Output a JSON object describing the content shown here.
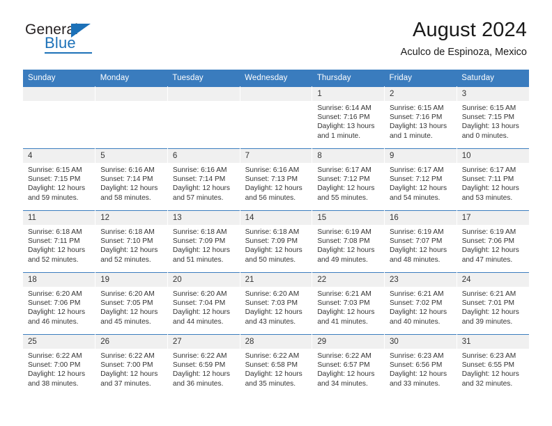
{
  "brand": {
    "name_top": "General",
    "name_bottom": "Blue",
    "triangle_color": "#1c71b8"
  },
  "header": {
    "title": "August 2024",
    "subtitle": "Aculco de Espinoza, Mexico",
    "header_bg": "#3a7cbe"
  },
  "weekday_headers": [
    "Sunday",
    "Monday",
    "Tuesday",
    "Wednesday",
    "Thursday",
    "Friday",
    "Saturday"
  ],
  "weeks": [
    [
      {
        "day": "",
        "lines": []
      },
      {
        "day": "",
        "lines": []
      },
      {
        "day": "",
        "lines": []
      },
      {
        "day": "",
        "lines": []
      },
      {
        "day": "1",
        "lines": [
          "Sunrise: 6:14 AM",
          "Sunset: 7:16 PM",
          "Daylight: 13 hours",
          "and 1 minute."
        ]
      },
      {
        "day": "2",
        "lines": [
          "Sunrise: 6:15 AM",
          "Sunset: 7:16 PM",
          "Daylight: 13 hours",
          "and 1 minute."
        ]
      },
      {
        "day": "3",
        "lines": [
          "Sunrise: 6:15 AM",
          "Sunset: 7:15 PM",
          "Daylight: 13 hours",
          "and 0 minutes."
        ]
      }
    ],
    [
      {
        "day": "4",
        "lines": [
          "Sunrise: 6:15 AM",
          "Sunset: 7:15 PM",
          "Daylight: 12 hours",
          "and 59 minutes."
        ]
      },
      {
        "day": "5",
        "lines": [
          "Sunrise: 6:16 AM",
          "Sunset: 7:14 PM",
          "Daylight: 12 hours",
          "and 58 minutes."
        ]
      },
      {
        "day": "6",
        "lines": [
          "Sunrise: 6:16 AM",
          "Sunset: 7:14 PM",
          "Daylight: 12 hours",
          "and 57 minutes."
        ]
      },
      {
        "day": "7",
        "lines": [
          "Sunrise: 6:16 AM",
          "Sunset: 7:13 PM",
          "Daylight: 12 hours",
          "and 56 minutes."
        ]
      },
      {
        "day": "8",
        "lines": [
          "Sunrise: 6:17 AM",
          "Sunset: 7:12 PM",
          "Daylight: 12 hours",
          "and 55 minutes."
        ]
      },
      {
        "day": "9",
        "lines": [
          "Sunrise: 6:17 AM",
          "Sunset: 7:12 PM",
          "Daylight: 12 hours",
          "and 54 minutes."
        ]
      },
      {
        "day": "10",
        "lines": [
          "Sunrise: 6:17 AM",
          "Sunset: 7:11 PM",
          "Daylight: 12 hours",
          "and 53 minutes."
        ]
      }
    ],
    [
      {
        "day": "11",
        "lines": [
          "Sunrise: 6:18 AM",
          "Sunset: 7:11 PM",
          "Daylight: 12 hours",
          "and 52 minutes."
        ]
      },
      {
        "day": "12",
        "lines": [
          "Sunrise: 6:18 AM",
          "Sunset: 7:10 PM",
          "Daylight: 12 hours",
          "and 52 minutes."
        ]
      },
      {
        "day": "13",
        "lines": [
          "Sunrise: 6:18 AM",
          "Sunset: 7:09 PM",
          "Daylight: 12 hours",
          "and 51 minutes."
        ]
      },
      {
        "day": "14",
        "lines": [
          "Sunrise: 6:18 AM",
          "Sunset: 7:09 PM",
          "Daylight: 12 hours",
          "and 50 minutes."
        ]
      },
      {
        "day": "15",
        "lines": [
          "Sunrise: 6:19 AM",
          "Sunset: 7:08 PM",
          "Daylight: 12 hours",
          "and 49 minutes."
        ]
      },
      {
        "day": "16",
        "lines": [
          "Sunrise: 6:19 AM",
          "Sunset: 7:07 PM",
          "Daylight: 12 hours",
          "and 48 minutes."
        ]
      },
      {
        "day": "17",
        "lines": [
          "Sunrise: 6:19 AM",
          "Sunset: 7:06 PM",
          "Daylight: 12 hours",
          "and 47 minutes."
        ]
      }
    ],
    [
      {
        "day": "18",
        "lines": [
          "Sunrise: 6:20 AM",
          "Sunset: 7:06 PM",
          "Daylight: 12 hours",
          "and 46 minutes."
        ]
      },
      {
        "day": "19",
        "lines": [
          "Sunrise: 6:20 AM",
          "Sunset: 7:05 PM",
          "Daylight: 12 hours",
          "and 45 minutes."
        ]
      },
      {
        "day": "20",
        "lines": [
          "Sunrise: 6:20 AM",
          "Sunset: 7:04 PM",
          "Daylight: 12 hours",
          "and 44 minutes."
        ]
      },
      {
        "day": "21",
        "lines": [
          "Sunrise: 6:20 AM",
          "Sunset: 7:03 PM",
          "Daylight: 12 hours",
          "and 43 minutes."
        ]
      },
      {
        "day": "22",
        "lines": [
          "Sunrise: 6:21 AM",
          "Sunset: 7:03 PM",
          "Daylight: 12 hours",
          "and 41 minutes."
        ]
      },
      {
        "day": "23",
        "lines": [
          "Sunrise: 6:21 AM",
          "Sunset: 7:02 PM",
          "Daylight: 12 hours",
          "and 40 minutes."
        ]
      },
      {
        "day": "24",
        "lines": [
          "Sunrise: 6:21 AM",
          "Sunset: 7:01 PM",
          "Daylight: 12 hours",
          "and 39 minutes."
        ]
      }
    ],
    [
      {
        "day": "25",
        "lines": [
          "Sunrise: 6:22 AM",
          "Sunset: 7:00 PM",
          "Daylight: 12 hours",
          "and 38 minutes."
        ]
      },
      {
        "day": "26",
        "lines": [
          "Sunrise: 6:22 AM",
          "Sunset: 7:00 PM",
          "Daylight: 12 hours",
          "and 37 minutes."
        ]
      },
      {
        "day": "27",
        "lines": [
          "Sunrise: 6:22 AM",
          "Sunset: 6:59 PM",
          "Daylight: 12 hours",
          "and 36 minutes."
        ]
      },
      {
        "day": "28",
        "lines": [
          "Sunrise: 6:22 AM",
          "Sunset: 6:58 PM",
          "Daylight: 12 hours",
          "and 35 minutes."
        ]
      },
      {
        "day": "29",
        "lines": [
          "Sunrise: 6:22 AM",
          "Sunset: 6:57 PM",
          "Daylight: 12 hours",
          "and 34 minutes."
        ]
      },
      {
        "day": "30",
        "lines": [
          "Sunrise: 6:23 AM",
          "Sunset: 6:56 PM",
          "Daylight: 12 hours",
          "and 33 minutes."
        ]
      },
      {
        "day": "31",
        "lines": [
          "Sunrise: 6:23 AM",
          "Sunset: 6:55 PM",
          "Daylight: 12 hours",
          "and 32 minutes."
        ]
      }
    ]
  ]
}
